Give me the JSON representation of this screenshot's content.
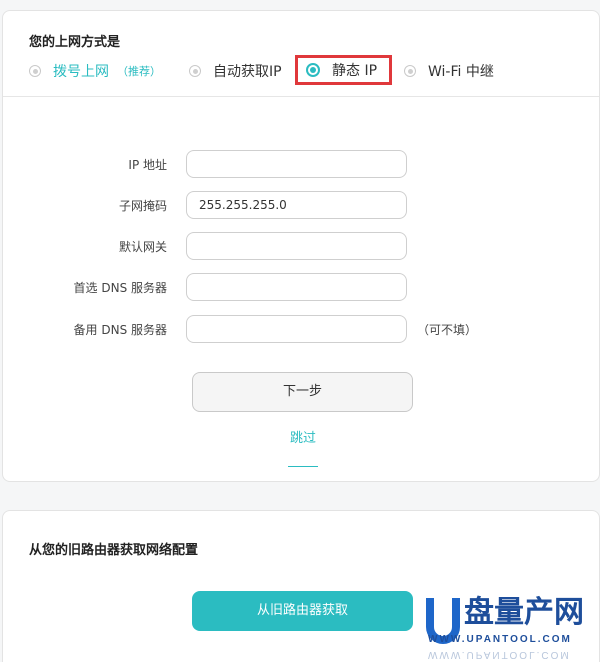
{
  "connection": {
    "title": "您的上网方式是",
    "modes": [
      {
        "label": "拨号上网",
        "sub": "（推荐）",
        "selected": false
      },
      {
        "label": "自动获取IP",
        "selected": false
      },
      {
        "label": "静态 IP",
        "selected": true
      },
      {
        "label": "Wi-Fi 中继",
        "selected": false
      }
    ]
  },
  "form": {
    "fields": [
      {
        "label": "IP 地址",
        "value": ""
      },
      {
        "label": "子网掩码",
        "value": "255.255.255.0"
      },
      {
        "label": "默认网关",
        "value": ""
      },
      {
        "label": "首选 DNS 服务器",
        "value": ""
      },
      {
        "label": "备用 DNS 服务器",
        "value": "",
        "note": "（可不填）"
      }
    ],
    "next_label": "下一步",
    "skip_label": "跳过"
  },
  "old_router": {
    "title": "从您的旧路由器获取网络配置",
    "button_label": "从旧路由器获取"
  },
  "watermark": {
    "brand": "盘量产网",
    "url": "WWW.UPANTOOL.COM"
  },
  "colors": {
    "accent": "#2bbcc1",
    "highlight_border": "#e0383b"
  }
}
